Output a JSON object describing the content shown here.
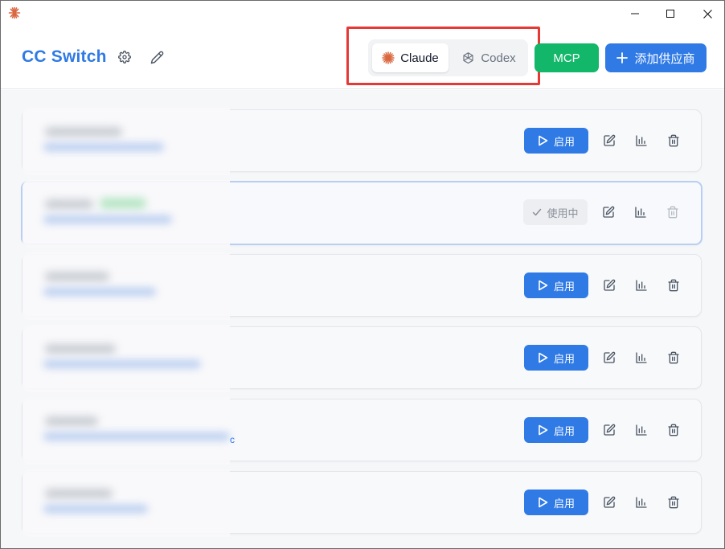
{
  "window": {
    "app_icon": "claude-starburst-icon",
    "controls": [
      "minimize-icon",
      "maximize-icon",
      "close-icon"
    ]
  },
  "header": {
    "title": "CC Switch",
    "settings_icon": "gear-icon",
    "edit_icon": "pencil-icon",
    "app_switcher": {
      "options": [
        {
          "label": "Claude",
          "icon": "claude-starburst-icon",
          "selected": true
        },
        {
          "label": "Codex",
          "icon": "openai-knot-icon",
          "selected": false
        }
      ]
    },
    "mcp_label": "MCP",
    "add_provider_label": "添加供应商"
  },
  "providers": [
    {
      "status": "idle",
      "action_label": "启用"
    },
    {
      "status": "active",
      "action_label": "使用中"
    },
    {
      "status": "idle",
      "action_label": "启用"
    },
    {
      "status": "idle",
      "action_label": "启用"
    },
    {
      "status": "idle",
      "action_label": "启用",
      "url_tail": "c"
    },
    {
      "status": "idle",
      "action_label": "启用"
    }
  ],
  "colors": {
    "brand": "#2f7ae5",
    "mcp": "#12b76a",
    "highlight": "#e53935",
    "claude_accent": "#d9673f"
  }
}
